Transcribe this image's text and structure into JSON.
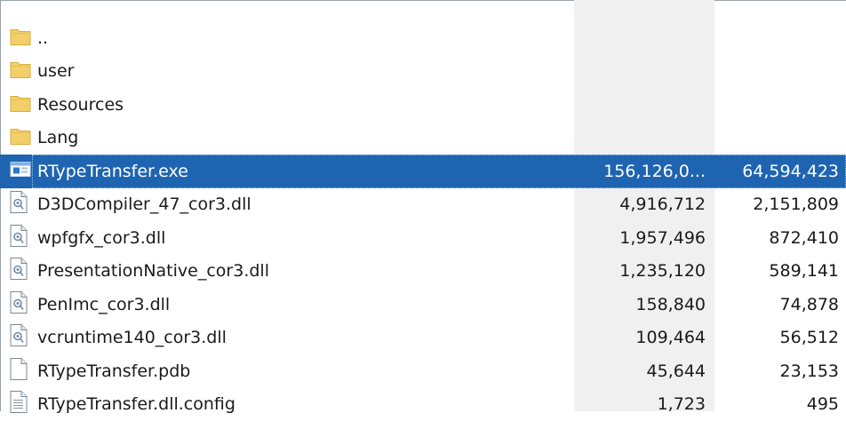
{
  "files": [
    {
      "name": "..",
      "size": "",
      "packed": "",
      "icon": "folder-icon",
      "type": "folder"
    },
    {
      "name": "user",
      "size": "",
      "packed": "",
      "icon": "folder-icon",
      "type": "folder"
    },
    {
      "name": "Resources",
      "size": "",
      "packed": "",
      "icon": "folder-icon",
      "type": "folder"
    },
    {
      "name": "Lang",
      "size": "",
      "packed": "",
      "icon": "folder-icon",
      "type": "folder"
    },
    {
      "name": "RTypeTransfer.exe",
      "size": "156,126,0...",
      "packed": "64,594,423",
      "icon": "application-icon",
      "type": "exe",
      "selected": true
    },
    {
      "name": "D3DCompiler_47_cor3.dll",
      "size": "4,916,712",
      "packed": "2,151,809",
      "icon": "dll-file-icon",
      "type": "dll"
    },
    {
      "name": "wpfgfx_cor3.dll",
      "size": "1,957,496",
      "packed": "872,410",
      "icon": "dll-file-icon",
      "type": "dll"
    },
    {
      "name": "PresentationNative_cor3.dll",
      "size": "1,235,120",
      "packed": "589,141",
      "icon": "dll-file-icon",
      "type": "dll"
    },
    {
      "name": "PenImc_cor3.dll",
      "size": "158,840",
      "packed": "74,878",
      "icon": "dll-file-icon",
      "type": "dll"
    },
    {
      "name": "vcruntime140_cor3.dll",
      "size": "109,464",
      "packed": "56,512",
      "icon": "dll-file-icon",
      "type": "dll"
    },
    {
      "name": "RTypeTransfer.pdb",
      "size": "45,644",
      "packed": "23,153",
      "icon": "blank-file-icon",
      "type": "pdb"
    },
    {
      "name": "RTypeTransfer.dll.config",
      "size": "1,723",
      "packed": "495",
      "icon": "text-file-icon",
      "type": "config"
    }
  ],
  "colors": {
    "selection": "#1f64b0",
    "folder": "#f3cf6a",
    "shaded_column": "#f0f0f0"
  }
}
